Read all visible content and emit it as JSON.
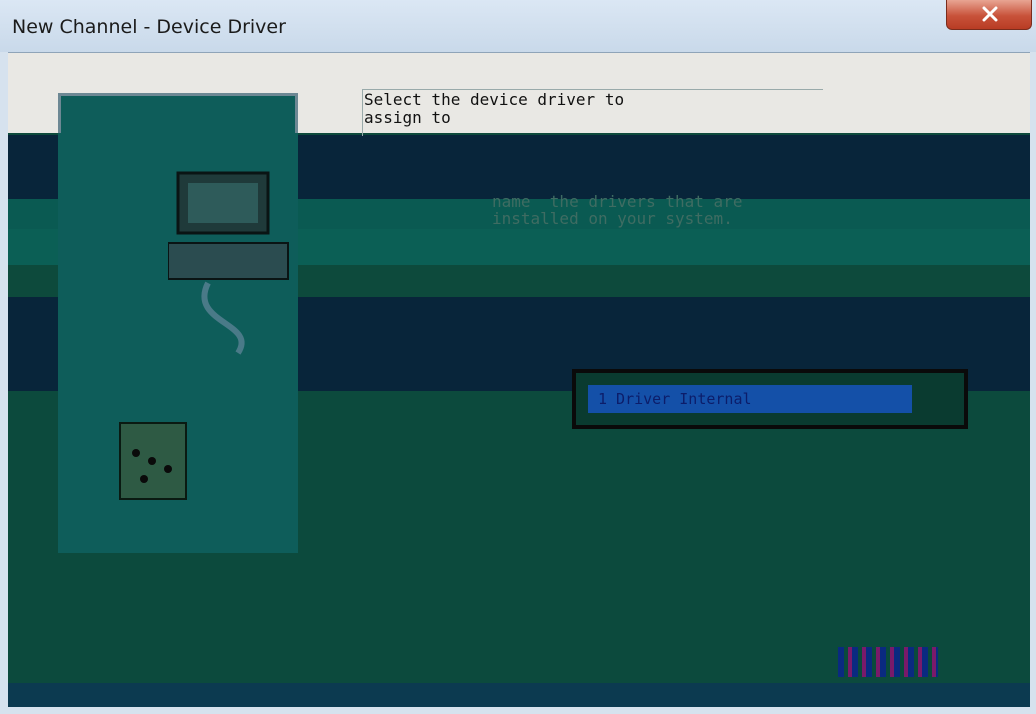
{
  "window": {
    "title": "New Channel - Device Driver",
    "close_label": "X"
  },
  "wizard": {
    "instructions": "Select the device driver to\nassign to",
    "details": "name  the drivers that are\ninstalled on your system.",
    "driver_list": {
      "items": [
        "1 Driver Internal"
      ],
      "selected_index": 0
    }
  },
  "colors": {
    "close_red": "#c8523a",
    "selection_blue": "#1450a8",
    "panel_teal": "#0e5d5a"
  },
  "icons": [
    "close-icon",
    "computer-icon",
    "modem-icon"
  ]
}
